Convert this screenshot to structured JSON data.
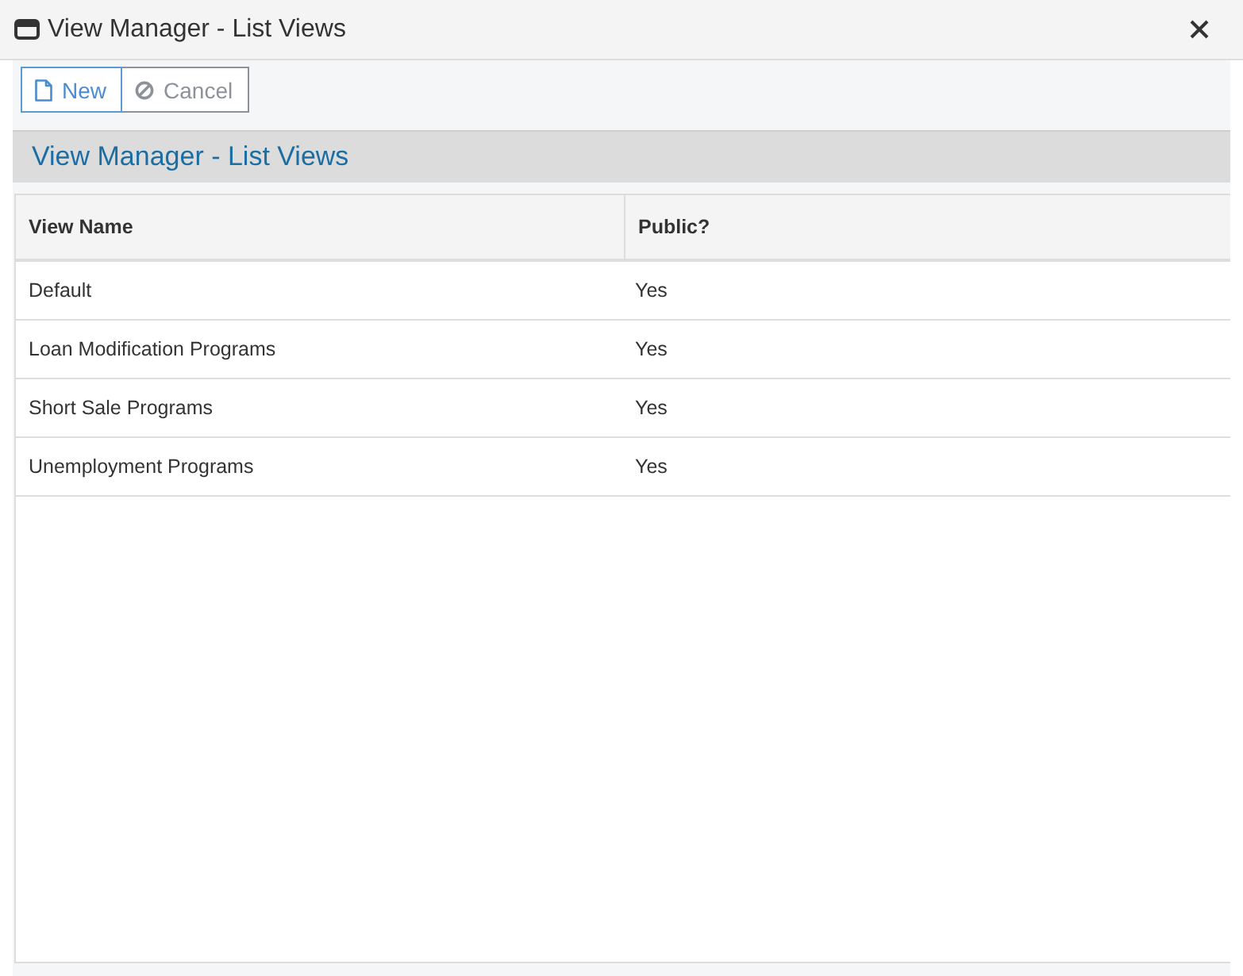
{
  "window": {
    "title": "View Manager - List Views"
  },
  "toolbar": {
    "buttons": [
      {
        "kind": "new",
        "label": "New",
        "disabled": false
      },
      {
        "kind": "cancel",
        "label": "Cancel",
        "disabled": true
      }
    ]
  },
  "section": {
    "title": "View Manager - List Views"
  },
  "table": {
    "columns": [
      "View Name",
      "Public?"
    ],
    "rows": [
      [
        "Default",
        "Yes"
      ],
      [
        "Loan Modification Programs",
        "Yes"
      ],
      [
        "Short Sale Programs",
        "Yes"
      ],
      [
        "Unemployment Programs",
        "Yes"
      ]
    ]
  }
}
